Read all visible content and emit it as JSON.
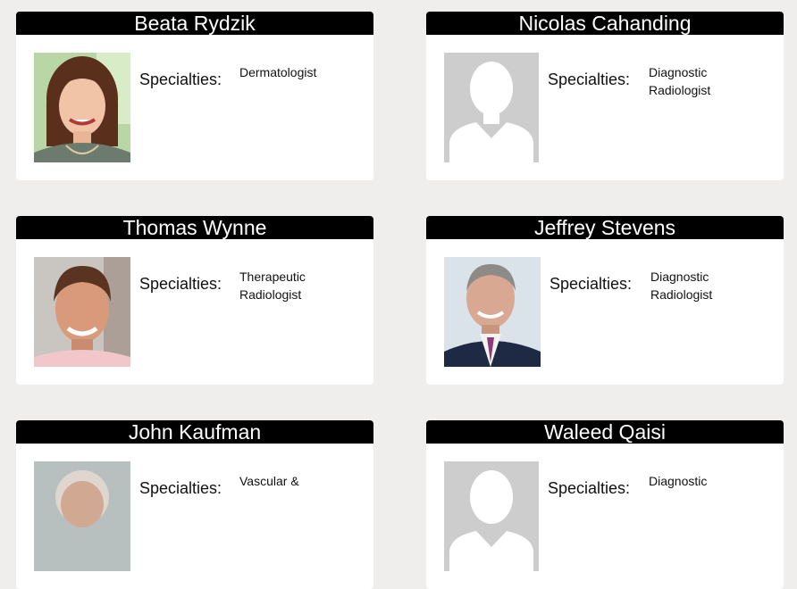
{
  "doctors": [
    {
      "name": "Beata Rydzik",
      "specialty_label": "Specialties:",
      "specialty": "Dermatologist",
      "photo": "photo-woman-brown-hair"
    },
    {
      "name": "Nicolas Cahanding",
      "specialty_label": "Specialties:",
      "specialty": "Diagnostic\nRadiologist",
      "photo": "placeholder-avatar"
    },
    {
      "name": "Thomas Wynne",
      "specialty_label": "Specialties:",
      "specialty": "Therapeutic\nRadiologist",
      "photo": "photo-man-smiling"
    },
    {
      "name": "Jeffrey Stevens",
      "specialty_label": "Specialties:",
      "specialty": "Diagnostic\nRadiologist",
      "photo": "photo-man-suit"
    },
    {
      "name": "John Kaufman",
      "specialty_label": "Specialties:",
      "specialty": "Vascular &",
      "photo": "photo-man-gray-hair"
    },
    {
      "name": "Waleed Qaisi",
      "specialty_label": "Specialties:",
      "specialty": "Diagnostic",
      "photo": "placeholder-avatar"
    }
  ]
}
